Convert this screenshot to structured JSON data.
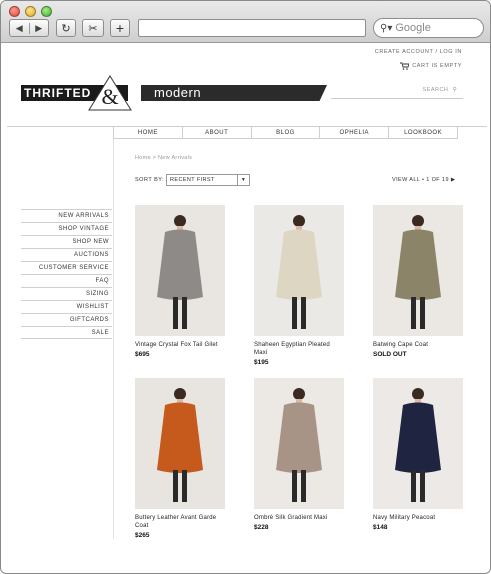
{
  "browser": {
    "search_placeholder": "Google",
    "back_icon": "◀",
    "forward_icon": "▶",
    "reload_icon": "↻",
    "share_icon": "✂",
    "add_icon": "+"
  },
  "header": {
    "create_account": "CREATE ACCOUNT / LOG IN",
    "cart": "CART IS EMPTY",
    "logo_left": "THRIFTED",
    "logo_amp": "&",
    "logo_right": "modern",
    "search_label": "SEARCH"
  },
  "menu": [
    "HOME",
    "ABOUT",
    "BLOG",
    "OPHELIA",
    "LOOKBOOK"
  ],
  "sidebar": [
    "NEW ARRIVALS",
    "SHOP VINTAGE",
    "SHOP NEW",
    "AUCTIONS",
    "CUSTOMER SERVICE",
    "FAQ",
    "SIZING",
    "WISHLIST",
    "GIFTCARDS",
    "SALE"
  ],
  "breadcrumb": "Home > New Arrivals",
  "sort": {
    "label": "SORT BY:",
    "value": "RECENT FIRST"
  },
  "pager": "VIEW ALL  •  1 OF 19 ▶",
  "products": [
    {
      "name": "Vintage Crystal Fox Tail Gilet",
      "price": "$695",
      "bg": "#e9e6e2",
      "garment": "#8d8a87"
    },
    {
      "name": "Shaheen Egyptian Pleated Maxi",
      "price": "$195",
      "bg": "#ebe9e5",
      "garment": "#ddd6c3"
    },
    {
      "name": "Batwing Cape Coat",
      "price": "SOLD OUT",
      "bg": "#ebe8e4",
      "garment": "#8b8469"
    },
    {
      "name": "Buttery Leather Avant Garde Coat",
      "price": "$265",
      "bg": "#e8e5e1",
      "garment": "#c55a1c"
    },
    {
      "name": "Ombré Silk Gradient Maxi",
      "price": "$228",
      "bg": "#ece9e5",
      "garment": "#a89486"
    },
    {
      "name": "Navy Military Peacoat",
      "price": "$148",
      "bg": "#ece9e6",
      "garment": "#1f2440"
    }
  ]
}
